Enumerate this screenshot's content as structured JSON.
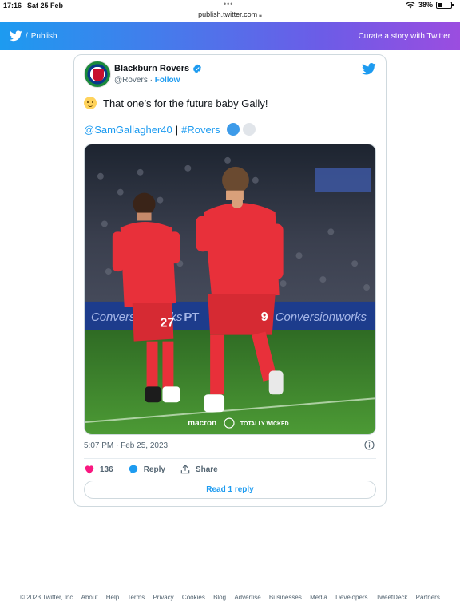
{
  "status_bar": {
    "time": "17:16",
    "date": "Sat 25 Feb",
    "battery": "38%",
    "battery_level": 0.38
  },
  "browser": {
    "url": "publish.twitter.com"
  },
  "header": {
    "brand_separator": "/",
    "brand_label": "Publish",
    "curate_link": "Curate a story with Twitter"
  },
  "tweet": {
    "author_name": "Blackburn Rovers",
    "handle": "@Rovers",
    "dot": "·",
    "follow": "Follow",
    "text_line1": "That one’s for the future baby Gally!",
    "mention": "@SamGallagher40",
    "separator": "|",
    "hashtag": "#Rovers",
    "timestamp": "5:07 PM · Feb 25, 2023",
    "likes": "136",
    "reply_label": "Reply",
    "share_label": "Share",
    "read_replies": "Read 1 reply"
  },
  "photo": {
    "board_text": "Conversionworks",
    "board_text_2": "PT",
    "sponsor": "macron",
    "sponsor_2": "TOTALLY WICKED",
    "shirt_number_left": "27",
    "shirt_number_right": "9",
    "colors": {
      "kit": "#e8303a",
      "pitch": "#3f8a2e",
      "board": "#1d3c8c"
    }
  },
  "footer": {
    "links": [
      "© 2023 Twitter, Inc",
      "About",
      "Help",
      "Terms",
      "Privacy",
      "Cookies",
      "Blog",
      "Advertise",
      "Businesses",
      "Media",
      "Developers",
      "TweetDeck",
      "Partners"
    ]
  },
  "colors": {
    "twitter_blue": "#1d9bf0",
    "gradient_end": "#9b4de0",
    "like_pink": "#f91880"
  }
}
